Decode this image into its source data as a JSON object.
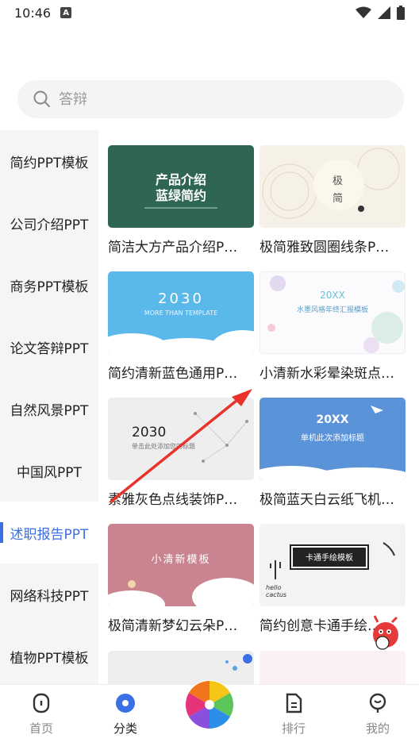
{
  "status": {
    "time": "10:46",
    "a_badge": "A"
  },
  "search": {
    "placeholder": "答辩"
  },
  "sidebar": {
    "items": [
      {
        "label": "简约PPT模板"
      },
      {
        "label": "公司介绍PPT"
      },
      {
        "label": "商务PPT模板"
      },
      {
        "label": "论文答辩PPT"
      },
      {
        "label": "自然风景PPT"
      },
      {
        "label": "中国风PPT"
      },
      {
        "label": "述职报告PPT"
      },
      {
        "label": "网络科技PPT"
      },
      {
        "label": "植物PPT模板"
      }
    ],
    "active_index": 6
  },
  "cards": [
    {
      "title": "简洁大方产品介绍P…",
      "thumb_text": "产品介绍",
      "thumb_text2": "蓝绿简约",
      "bg": "#2f6553"
    },
    {
      "title": "极简雅致圆圈线条P…",
      "thumb_text": "极",
      "thumb_text2": "简",
      "bg": "#f6f1e6"
    },
    {
      "title": "简约清新蓝色通用P…",
      "thumb_text": "2030",
      "thumb_text2": "MORE THAN TEMPLATE",
      "bg": "#5ab8ea"
    },
    {
      "title": "小清新水彩晕染斑点…",
      "thumb_text": "20XX",
      "thumb_text2": "水墨风格年终汇报模板",
      "bg": "#fbfbfd"
    },
    {
      "title": "素雅灰色点线装饰P…",
      "thumb_text": "2030",
      "thumb_text2": "单击此处添加您的标题",
      "bg": "#eeeeee"
    },
    {
      "title": "极简蓝天白云纸飞机…",
      "thumb_text": "20XX",
      "thumb_text2": "单机此次添加标题",
      "bg": "#5b93d8"
    },
    {
      "title": "极简清新梦幻云朵P…",
      "thumb_text": "小清新模板",
      "thumb_text2": "",
      "bg": "#c9848f"
    },
    {
      "title": "简约创意卡通手绘…",
      "thumb_text": "卡通手绘模板",
      "thumb_text2": "hello cactus",
      "bg": "#f3f3f3"
    }
  ],
  "bottom_nav": [
    {
      "label": "首页",
      "icon": "home-icon"
    },
    {
      "label": "分类",
      "icon": "category-icon"
    },
    {
      "label": "",
      "icon": "pinwheel-icon"
    },
    {
      "label": "排行",
      "icon": "ranking-icon"
    },
    {
      "label": "我的",
      "icon": "profile-icon"
    }
  ],
  "colors": {
    "accent": "#3a6fe6",
    "arrow": "#e8332a"
  }
}
